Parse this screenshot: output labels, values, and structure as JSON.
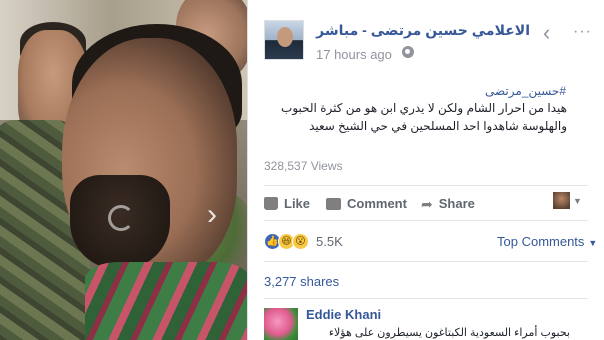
{
  "video": {
    "next_icon": "›",
    "icons": [
      "loading-spinner-icon",
      "chevron-right-icon"
    ]
  },
  "header": {
    "author": "الاعلامي حسين مرتضى - مباشر",
    "timestamp": "17 hours ago",
    "privacy_icon": "globe-icon",
    "back_icon": "‹",
    "more_icon": "···"
  },
  "post": {
    "hashtag": "#حسين_مرتضى",
    "text": "هيدا من احرار الشام ولكن لا يدري ابن هو من كثرة الحبوب والهلوسة شاهدوا احد المسلحين في حي الشيخ سعيد",
    "views": "328,537 Views"
  },
  "actions": {
    "like": "Like",
    "comment": "Comment",
    "share": "Share"
  },
  "reactions": {
    "count": "5.5K",
    "types": [
      "like",
      "haha",
      "wow"
    ],
    "top_comments": "Top Comments"
  },
  "shares": "3,277 shares",
  "comments": [
    {
      "name": "Eddie Khani",
      "text": "بحبوب أمراء السعودية الكبتاغون يسيطرون على هؤلاء ويزجون بهم"
    }
  ],
  "colors": {
    "link_blue": "#365899",
    "text_dark": "#1d2129",
    "meta_grey": "#90949c",
    "like_blue": "#4267b2"
  }
}
